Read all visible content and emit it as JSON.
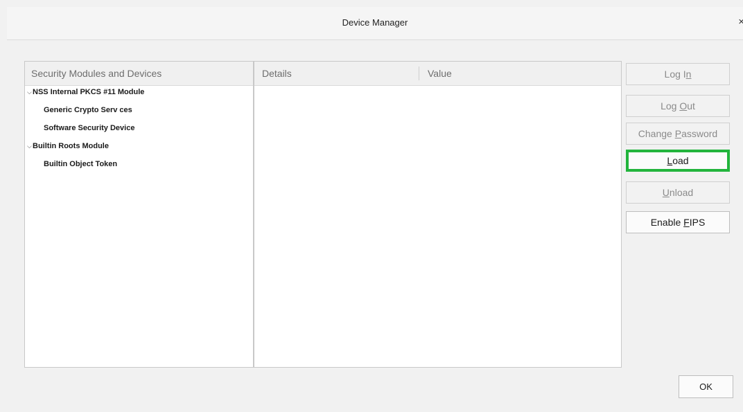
{
  "window": {
    "title": "Device Manager",
    "close_glyph": "×"
  },
  "tree": {
    "header": "Security Modules and Devices",
    "items": [
      {
        "label": "NSS Internal PKCS #11 Module",
        "level": 0,
        "expanded": true,
        "twisty": "⌵"
      },
      {
        "label": "Generic Crypto Serv ces",
        "level": 1
      },
      {
        "label": "Software Security Device",
        "level": 1
      },
      {
        "label": "Builtin Roots Module",
        "level": 0,
        "expanded": true,
        "twisty": "⌵"
      },
      {
        "label": "Builtin Object Token",
        "level": 1
      }
    ]
  },
  "details": {
    "col_details": "Details",
    "col_value": "Value"
  },
  "buttons": {
    "login": {
      "pre": "Log I",
      "accel": "n",
      "post": "",
      "enabled": false
    },
    "logout": {
      "pre": "Log ",
      "accel": "O",
      "post": "ut",
      "enabled": false
    },
    "change_password": {
      "pre": "Change ",
      "accel": "P",
      "post": "assword",
      "enabled": false
    },
    "load": {
      "pre": "",
      "accel": "L",
      "post": "oad",
      "enabled": true,
      "highlight_color": "#22b43c"
    },
    "unload": {
      "pre": "",
      "accel": "U",
      "post": "nload",
      "enabled": false
    },
    "enable_fips": {
      "pre": "Enable ",
      "accel": "F",
      "post": "IPS",
      "enabled": true
    }
  },
  "footer": {
    "ok_label": "OK"
  }
}
